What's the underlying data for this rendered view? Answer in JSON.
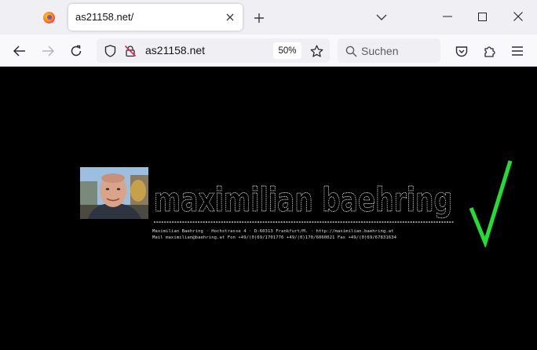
{
  "browser": {
    "tab": {
      "title": "as21158.net/"
    },
    "url": "as21158.net",
    "zoom": "50%",
    "search_placeholder": "Suchen"
  },
  "icons": {
    "app": "firefox-icon",
    "tab_close": "close-icon",
    "new_tab": "plus-icon",
    "list_tabs": "chevron-down-icon",
    "minimize": "minimize-icon",
    "maximize": "maximize-icon",
    "close": "close-icon",
    "back": "back-arrow-icon",
    "forward": "forward-arrow-icon",
    "reload": "reload-icon",
    "tracking": "shield-icon",
    "insecure": "insecure-lock-icon",
    "bookmark": "star-icon",
    "search": "search-icon",
    "pocket": "pocket-icon",
    "extensions": "puzzle-icon",
    "menu": "hamburger-menu-icon"
  },
  "page": {
    "logo_text": "maximilian baehring",
    "info_line_1": "Maximilian Baehring · Hochstrasse 4 · D-60313 Frankfurt/M. · http://maximilian.baehring.at",
    "info_line_2": "Mail maximilian@baehring.at Fon +49/(0)69/1701776 +49/(0)170/6060021 Fax +49/(0)69/67831634"
  },
  "colors": {
    "page_background": "#000000",
    "logo_outline": "#e8e8e8",
    "check_mark": "#22dd33",
    "tabstrip": "#f0f0f4",
    "navbar": "#f9f9fb"
  }
}
